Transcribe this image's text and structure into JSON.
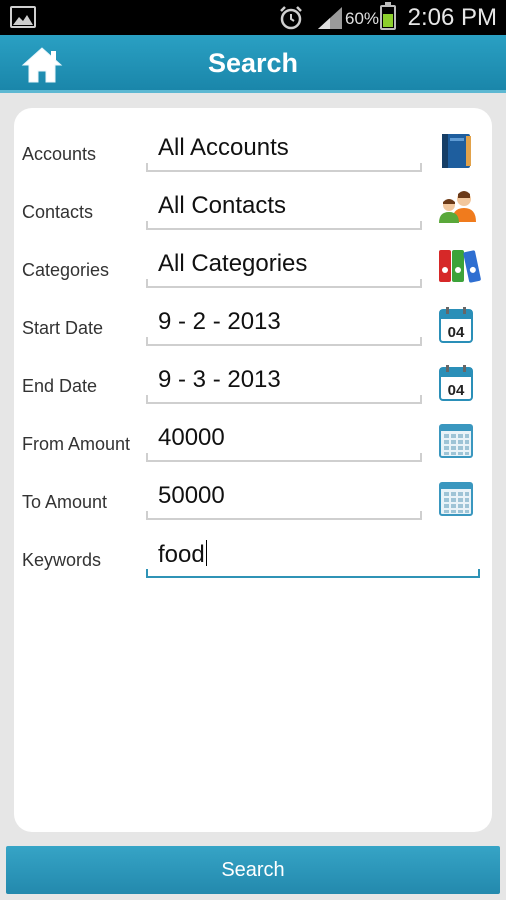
{
  "status_bar": {
    "battery_text": "60%",
    "time": "2:06 PM",
    "battery_level": 0.6,
    "icons": [
      "gallery-icon",
      "alarm-icon",
      "signal-icon",
      "battery-icon"
    ]
  },
  "header": {
    "title": "Search",
    "home_icon": "home-icon",
    "colors": {
      "bar": "#1a86aa",
      "accent": "#2f93b6"
    }
  },
  "form": {
    "accounts": {
      "label": "Accounts",
      "value": "All Accounts",
      "icon": "book-icon"
    },
    "contacts": {
      "label": "Contacts",
      "value": "All Contacts",
      "icon": "contacts-icon"
    },
    "categories": {
      "label": "Categories",
      "value": "All Categories",
      "icon": "binders-icon"
    },
    "start_date": {
      "label": "Start Date",
      "value": "9 - 2 - 2013",
      "icon": "calendar-icon",
      "icon_text": "04"
    },
    "end_date": {
      "label": "End Date",
      "value": "9 - 3 - 2013",
      "icon": "calendar-icon",
      "icon_text": "04"
    },
    "from_amount": {
      "label": "From Amount",
      "value": "40000",
      "icon": "calculator-icon"
    },
    "to_amount": {
      "label": "To Amount",
      "value": "50000",
      "icon": "calculator-icon"
    },
    "keywords": {
      "label": "Keywords",
      "value": "food"
    }
  },
  "footer": {
    "search_label": "Search"
  }
}
